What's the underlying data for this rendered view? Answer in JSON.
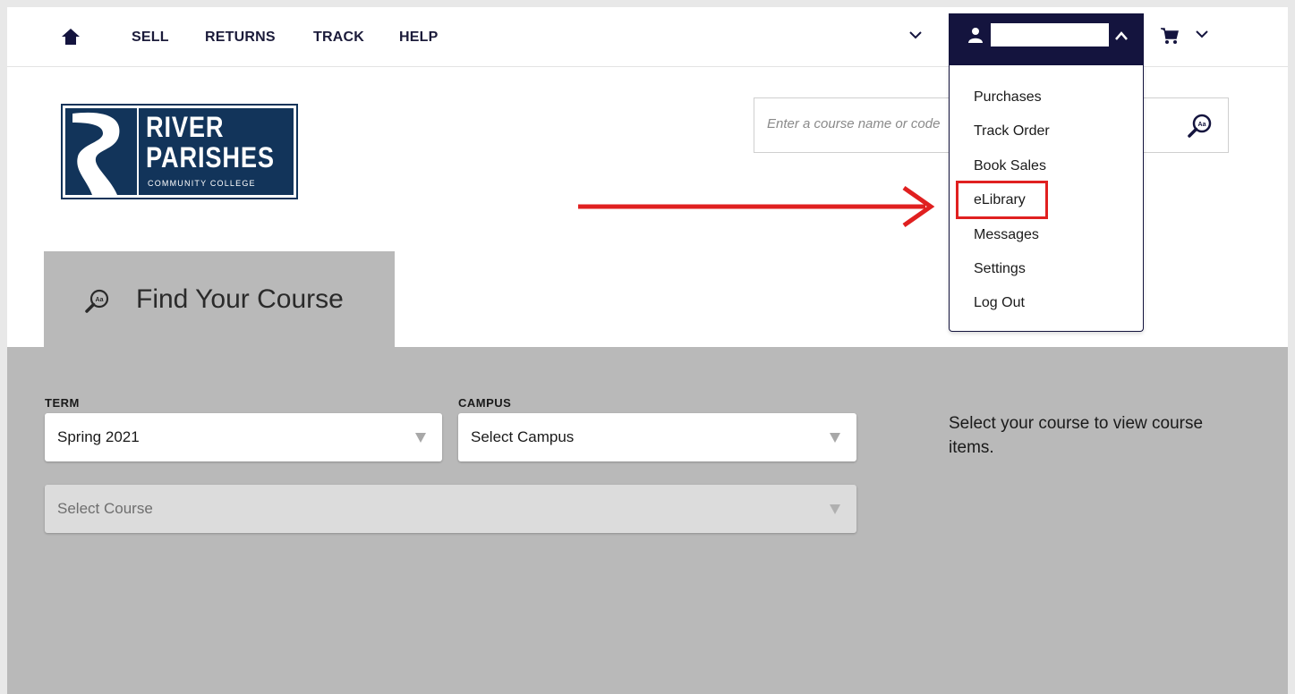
{
  "nav": {
    "links": [
      "SELL",
      "RETURNS",
      "TRACK",
      "HELP"
    ]
  },
  "logo": {
    "line1": "RIVER",
    "line2": "PARISHES",
    "line3": "COMMUNITY COLLEGE"
  },
  "search": {
    "placeholder": "Enter a course name or code"
  },
  "account_menu": {
    "items": [
      "Purchases",
      "Track Order",
      "Book Sales",
      "eLibrary",
      "Messages",
      "Settings",
      "Log Out"
    ],
    "highlighted": "eLibrary"
  },
  "tab": {
    "label": "Find Your Course"
  },
  "form": {
    "term_label": "TERM",
    "term_value": "Spring 2021",
    "campus_label": "CAMPUS",
    "campus_value": "Select Campus",
    "course_value": "Select Course",
    "helper_text": "Select your course to view course items."
  },
  "colors": {
    "navy": "#14143e",
    "logo_blue": "#12345a",
    "panel_gray": "#b9b9b9",
    "annotation_red": "#e02020"
  }
}
